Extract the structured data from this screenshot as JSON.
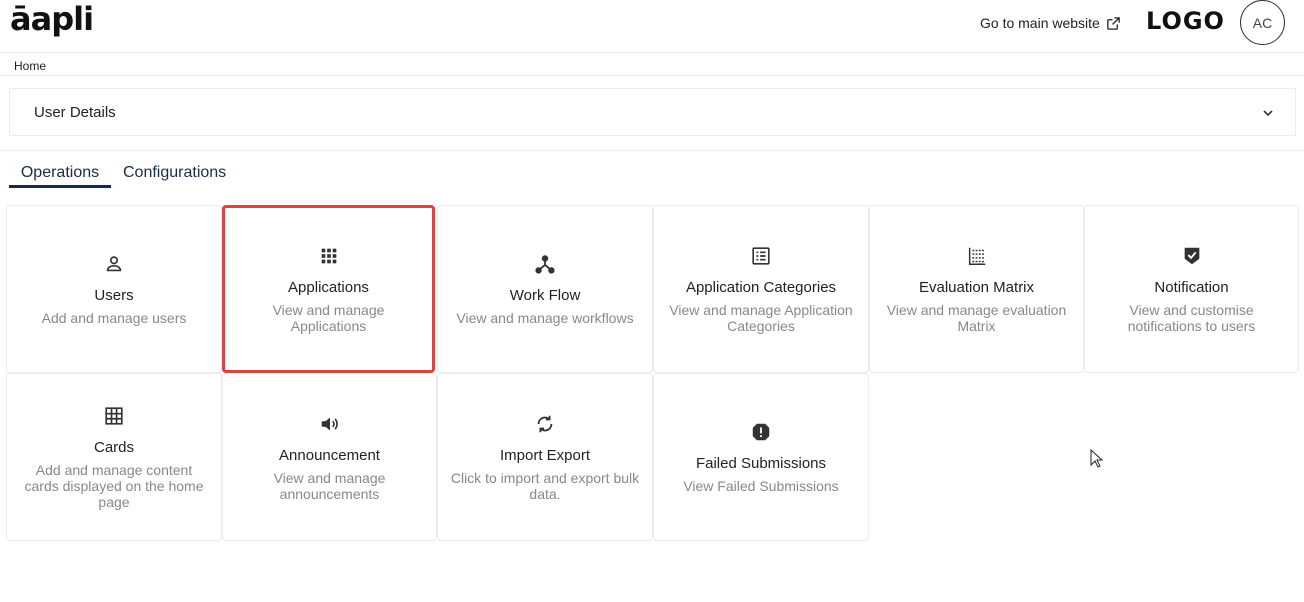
{
  "header": {
    "brand": "āapli",
    "main_website_link": "Go to main website",
    "logo": "LOGO",
    "avatar_initials": "AC"
  },
  "breadcrumb": {
    "home": "Home"
  },
  "user_details": {
    "title": "User Details"
  },
  "tabs": [
    {
      "label": "Operations",
      "active": true
    },
    {
      "label": "Configurations",
      "active": false
    }
  ],
  "cards": [
    {
      "title": "Users",
      "desc": "Add and manage users",
      "icon": "user-icon"
    },
    {
      "title": "Applications",
      "desc": "View and manage Applications",
      "icon": "grid-dots-icon",
      "selected": true
    },
    {
      "title": "Work Flow",
      "desc": "View and manage workflows",
      "icon": "workflow-icon"
    },
    {
      "title": "Application Categories",
      "desc": "View and manage Application Categories",
      "icon": "list-box-icon"
    },
    {
      "title": "Evaluation Matrix",
      "desc": "View and manage evaluation Matrix",
      "icon": "matrix-icon"
    },
    {
      "title": "Notification",
      "desc": "View and customise notifications to users",
      "icon": "shield-check-icon"
    },
    {
      "title": "Cards",
      "desc": "Add and manage content cards displayed on the home page",
      "icon": "table-grid-icon"
    },
    {
      "title": "Announcement",
      "desc": "View and manage announcements",
      "icon": "speaker-icon"
    },
    {
      "title": "Import Export",
      "desc": "Click to import and export bulk data.",
      "icon": "sync-icon"
    },
    {
      "title": "Failed Submissions",
      "desc": "View Failed Submissions",
      "icon": "alert-icon"
    }
  ],
  "colors": {
    "accent": "#1a2b4a",
    "selected_border": "#d64545",
    "muted_text": "#888888",
    "border": "#ececec"
  }
}
